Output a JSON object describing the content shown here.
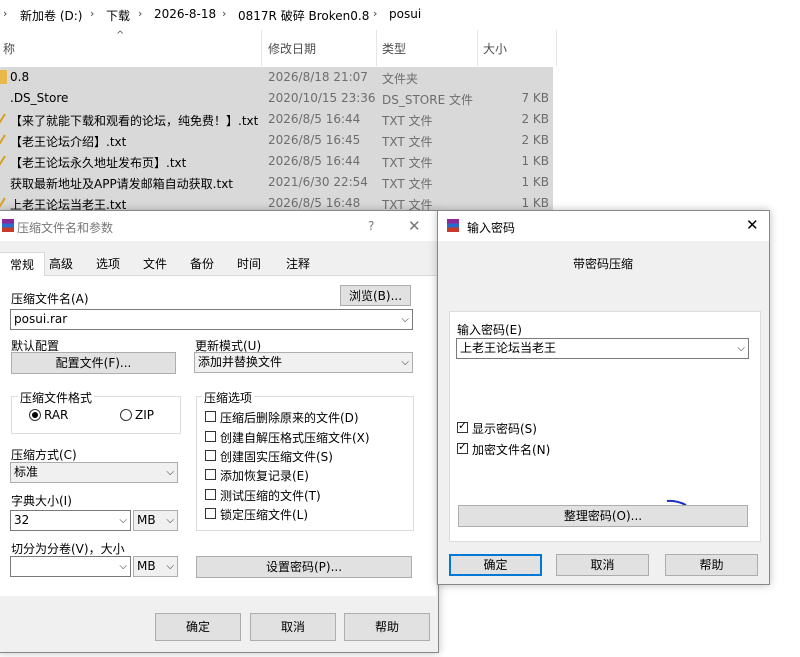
{
  "breadcrumb": [
    "新加卷 (D:)",
    "下载",
    "2026-8-18",
    "0817R 破碎 Broken0.8",
    "posui"
  ],
  "columns": {
    "name": "称",
    "date": "修改日期",
    "type": "类型",
    "size": "大小"
  },
  "files": [
    {
      "name": "0.8",
      "date": "2026/8/18 21:07",
      "type": "文件夹",
      "size": ""
    },
    {
      "name": ".DS_Store",
      "date": "2020/10/15 23:36",
      "type": "DS_STORE 文件",
      "size": "7 KB"
    },
    {
      "name": "【来了就能下载和观看的论坛，纯免费！】.txt",
      "date": "2026/8/5 16:44",
      "type": "TXT 文件",
      "size": "2 KB"
    },
    {
      "name": "【老王论坛介绍】.txt",
      "date": "2026/8/5 16:45",
      "type": "TXT 文件",
      "size": "2 KB"
    },
    {
      "name": "【老王论坛永久地址发布页】.txt",
      "date": "2026/8/5 16:44",
      "type": "TXT 文件",
      "size": "1 KB"
    },
    {
      "name": "获取最新地址及APP请发邮箱自动获取.txt",
      "date": "2021/6/30 22:54",
      "type": "TXT 文件",
      "size": "1 KB"
    },
    {
      "name": "上老王论坛当老王.txt",
      "date": "2026/8/5 16:48",
      "type": "TXT 文件",
      "size": "1 KB"
    }
  ],
  "archive_dialog": {
    "title": "压缩文件名和参数",
    "help_glyph": "?",
    "tabs": [
      "常规",
      "高级",
      "选项",
      "文件",
      "备份",
      "时间",
      "注释"
    ],
    "filename_label": "压缩文件名(A)",
    "browse_button": "浏览(B)...",
    "filename_value": "posui.rar",
    "default_config_label": "默认配置",
    "profiles_button": "配置文件(F)...",
    "update_mode_label": "更新模式(U)",
    "update_mode_value": "添加并替换文件",
    "format_label": "压缩文件格式",
    "format_rar": "RAR",
    "format_zip": "ZIP",
    "options_label": "压缩选项",
    "options": [
      {
        "label": "压缩后删除原来的文件(D)",
        "checked": false
      },
      {
        "label": "创建自解压格式压缩文件(X)",
        "checked": false
      },
      {
        "label": "创建固实压缩文件(S)",
        "checked": false
      },
      {
        "label": "添加恢复记录(E)",
        "checked": false
      },
      {
        "label": "测试压缩的文件(T)",
        "checked": false
      },
      {
        "label": "锁定压缩文件(L)",
        "checked": false
      }
    ],
    "method_label": "压缩方式(C)",
    "method_value": "标准",
    "dict_label": "字典大小(I)",
    "dict_value": "32",
    "dict_unit": "MB",
    "split_label": "切分为分卷(V)，大小",
    "split_value": "",
    "split_unit": "MB",
    "set_password_button": "设置密码(P)...",
    "ok": "确定",
    "cancel": "取消",
    "help": "帮助"
  },
  "password_dialog": {
    "title": "输入密码",
    "heading": "带密码压缩",
    "enter_label": "输入密码(E)",
    "password_value": "上老王论坛当老王",
    "show_password": "显示密码(S)",
    "show_password_checked": true,
    "encrypt_names": "加密文件名(N)",
    "encrypt_names_checked": true,
    "organize_button": "整理密码(O)...",
    "ok": "确定",
    "cancel": "取消",
    "help": "帮助"
  },
  "colors": {
    "row_selected": "#cce8ff",
    "row_inactive": "#d9d9d9",
    "accent": "#0078d7"
  }
}
